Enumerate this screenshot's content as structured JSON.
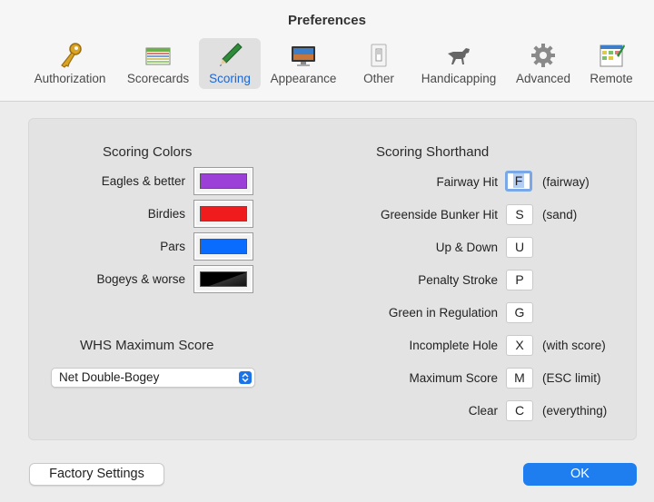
{
  "window": {
    "title": "Preferences"
  },
  "toolbar": {
    "items": [
      {
        "label": "Authorization",
        "icon": "key-icon"
      },
      {
        "label": "Scorecards",
        "icon": "scorecard-icon"
      },
      {
        "label": "Scoring",
        "icon": "pencil-icon",
        "selected": true
      },
      {
        "label": "Appearance",
        "icon": "monitor-icon"
      },
      {
        "label": "Other",
        "icon": "switch-icon"
      },
      {
        "label": "Handicapping",
        "icon": "horse-icon"
      },
      {
        "label": "Advanced",
        "icon": "gear-icon"
      },
      {
        "label": "Remote",
        "icon": "remote-scorecard-icon"
      }
    ]
  },
  "scoring_colors": {
    "heading": "Scoring Colors",
    "rows": [
      {
        "label": "Eagles & better",
        "color": "#9b3fd8"
      },
      {
        "label": "Birdies",
        "color": "#ee1c1c"
      },
      {
        "label": "Pars",
        "color": "#0a6bff"
      },
      {
        "label": "Bogeys & worse",
        "color": "#000000"
      }
    ]
  },
  "whs": {
    "heading": "WHS Maximum Score",
    "selected": "Net Double-Bogey"
  },
  "shorthand": {
    "heading": "Scoring Shorthand",
    "rows": [
      {
        "label": "Fairway Hit",
        "key": "F",
        "hint": "(fairway)",
        "focused": true
      },
      {
        "label": "Greenside Bunker Hit",
        "key": "S",
        "hint": "(sand)"
      },
      {
        "label": "Up & Down",
        "key": "U",
        "hint": ""
      },
      {
        "label": "Penalty Stroke",
        "key": "P",
        "hint": ""
      },
      {
        "label": "Green in Regulation",
        "key": "G",
        "hint": ""
      },
      {
        "label": "Incomplete Hole",
        "key": "X",
        "hint": "(with score)"
      },
      {
        "label": "Maximum Score",
        "key": "M",
        "hint": "(ESC limit)"
      },
      {
        "label": "Clear",
        "key": "C",
        "hint": "(everything)"
      }
    ]
  },
  "buttons": {
    "factory": "Factory Settings",
    "ok": "OK"
  },
  "colors": {
    "accent": "#1e7ef0"
  }
}
